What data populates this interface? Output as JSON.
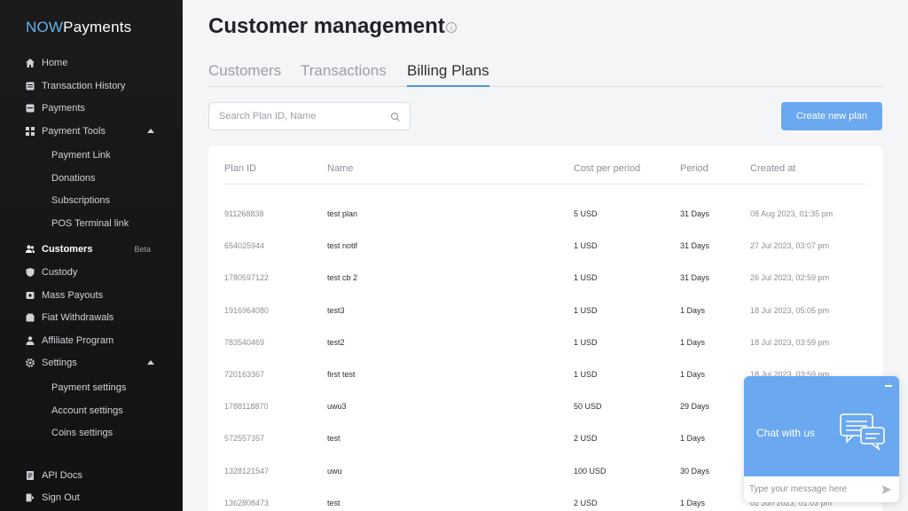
{
  "brand": {
    "part1": "NOW",
    "part2": "Payments"
  },
  "sidebar": {
    "items": [
      {
        "label": "Home",
        "icon": "home-icon"
      },
      {
        "label": "Transaction History",
        "icon": "history-icon"
      },
      {
        "label": "Payments",
        "icon": "payments-icon"
      },
      {
        "label": "Payment Tools",
        "icon": "grid-icon"
      },
      {
        "label": "Customers",
        "icon": "users-icon",
        "badge": "Beta"
      },
      {
        "label": "Custody",
        "icon": "shield-icon"
      },
      {
        "label": "Mass Payouts",
        "icon": "payouts-icon"
      },
      {
        "label": "Fiat Withdrawals",
        "icon": "bank-icon"
      },
      {
        "label": "Affiliate Program",
        "icon": "person-icon"
      },
      {
        "label": "Settings",
        "icon": "gear-icon"
      },
      {
        "label": "API Docs",
        "icon": "docs-icon"
      },
      {
        "label": "Sign Out",
        "icon": "signout-icon"
      }
    ],
    "payment_tools_sub": [
      "Payment Link",
      "Donations",
      "Subscriptions",
      "POS Terminal link"
    ],
    "settings_sub": [
      "Payment settings",
      "Account settings",
      "Coins settings"
    ]
  },
  "header": {
    "title": "Customer management"
  },
  "tabs": [
    "Customers",
    "Transactions",
    "Billing Plans"
  ],
  "search": {
    "placeholder": "Search Plan ID, Name"
  },
  "create_button": "Create new plan",
  "table": {
    "headers": [
      "Plan ID",
      "Name",
      "Cost per period",
      "Period",
      "Created at"
    ],
    "rows": [
      [
        "911268838",
        "test plan",
        "5 USD",
        "31 Days",
        "08 Aug 2023, 01:35 pm"
      ],
      [
        "654025944",
        "test notif",
        "1 USD",
        "31 Days",
        "27 Jul 2023, 03:07 pm"
      ],
      [
        "1780597122",
        "test cb 2",
        "1 USD",
        "31 Days",
        "26 Jul 2023, 02:59 pm"
      ],
      [
        "1916964080",
        "test3",
        "1 USD",
        "1 Days",
        "18 Jul 2023, 05:05 pm"
      ],
      [
        "783540469",
        "test2",
        "1 USD",
        "1 Days",
        "18 Jul 2023, 03:59 pm"
      ],
      [
        "720163367",
        "first test",
        "1 USD",
        "1 Days",
        "18 Jul 2023, 03:59 pm"
      ],
      [
        "1788118870",
        "uwu3",
        "50 USD",
        "29 Days",
        ""
      ],
      [
        "572557357",
        "test",
        "2 USD",
        "1 Days",
        ""
      ],
      [
        "1328121547",
        "uwu",
        "100 USD",
        "30 Days",
        ""
      ],
      [
        "1362808473",
        "test",
        "2 USD",
        "1 Days",
        "02 Jun 2023, 01:03 pm"
      ]
    ]
  },
  "chat": {
    "title": "Chat with us",
    "placeholder": "Type your message here"
  },
  "colors": {
    "accent": "#6aa8ef",
    "sidebar": "#161616",
    "brand_now": "#5fb3f0"
  }
}
